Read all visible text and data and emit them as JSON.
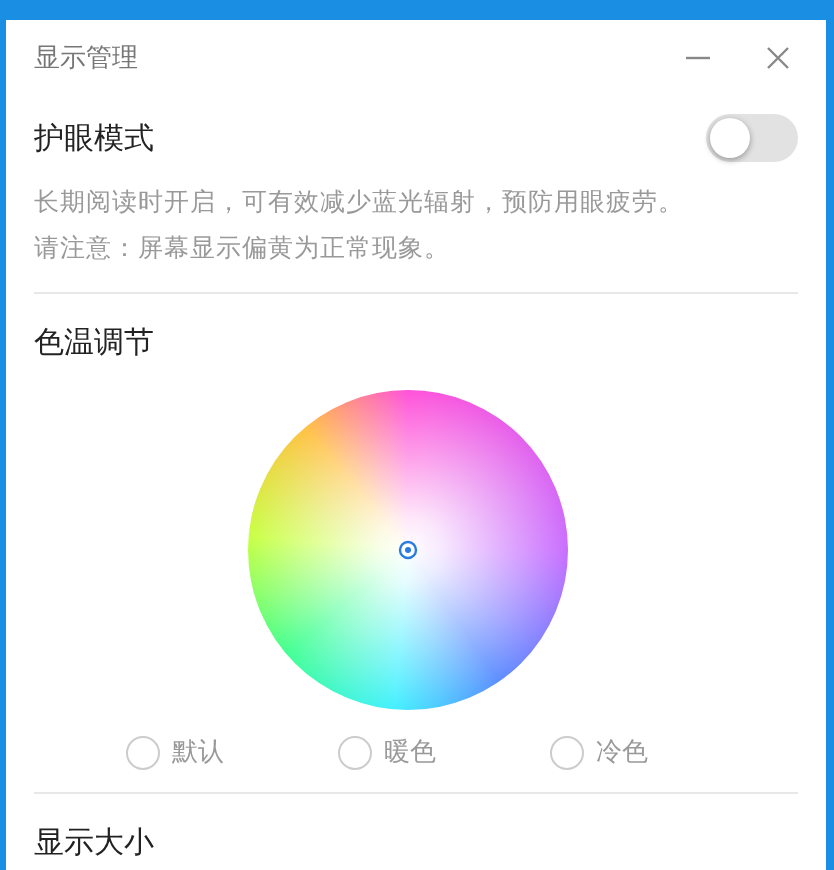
{
  "window": {
    "title": "显示管理"
  },
  "eye_care": {
    "title": "护眼模式",
    "on": false,
    "description": [
      "长期阅读时开启，可有效减少蓝光辐射，预防用眼疲劳。",
      "请注意：屏幕显示偏黄为正常现象。"
    ]
  },
  "color_temperature": {
    "title": "色温调节",
    "presets": [
      {
        "label": "默认",
        "selected": false
      },
      {
        "label": "暖色",
        "selected": false
      },
      {
        "label": "冷色",
        "selected": false
      }
    ]
  },
  "display_size": {
    "title": "显示大小"
  }
}
